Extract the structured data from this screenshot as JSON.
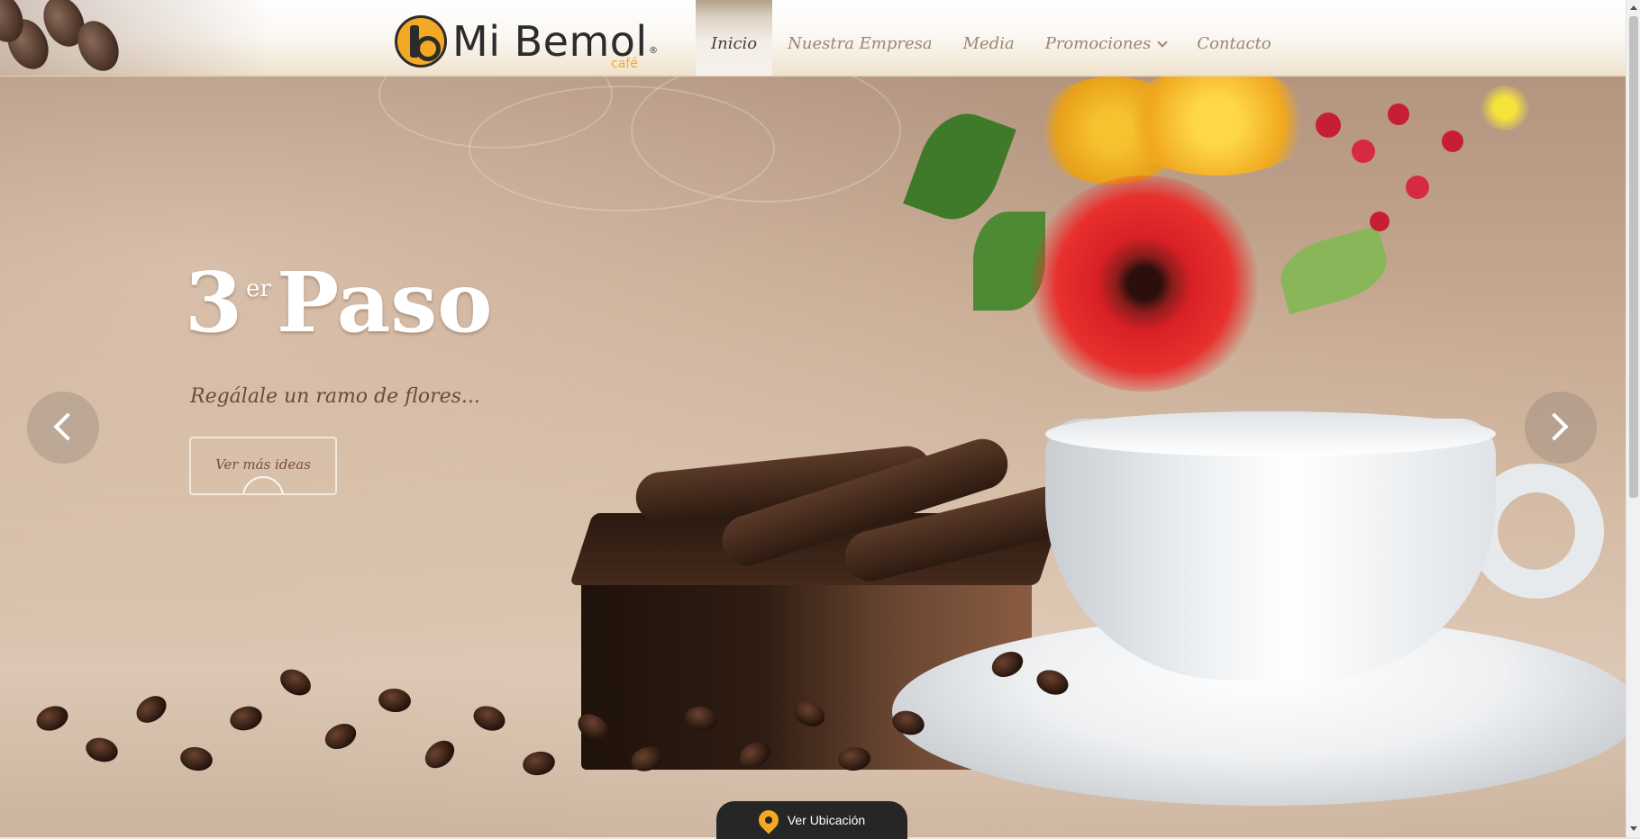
{
  "header": {
    "logo": {
      "name": "Mi Bemol",
      "registered": "®",
      "tagline": "café"
    },
    "nav": [
      {
        "label": "Inicio",
        "active": true
      },
      {
        "label": "Nuestra Empresa",
        "active": false
      },
      {
        "label": "Media",
        "active": false
      },
      {
        "label": "Promociones",
        "active": false,
        "dropdown": true
      },
      {
        "label": "Contacto",
        "active": false
      }
    ]
  },
  "hero": {
    "title_number": "3",
    "title_superscript": "er",
    "title_word": "Paso",
    "subtitle": "Regálale un ramo de flores...",
    "button_label": "Ver más ideas",
    "prev_icon": "chevron-left-icon",
    "next_icon": "chevron-right-icon"
  },
  "location": {
    "label": "Ver Ubicación",
    "icon": "map-pin-icon"
  },
  "colors": {
    "accent": "#f4a924",
    "nav_text": "#9a8676",
    "nav_active_text": "#4c3d34",
    "subtitle": "#6e4a38",
    "location_bar": "#262626"
  }
}
